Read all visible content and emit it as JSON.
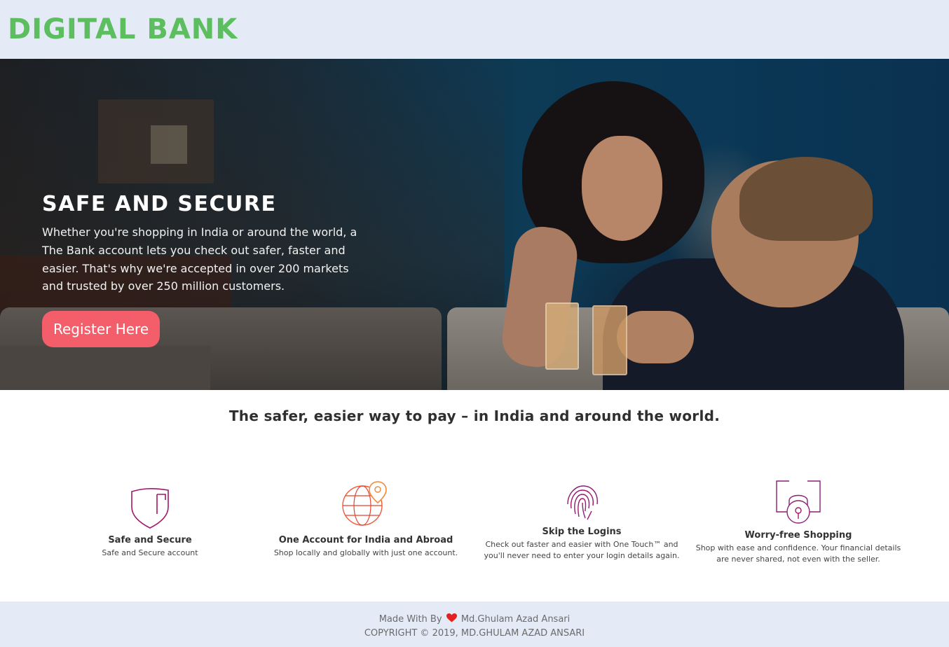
{
  "header": {
    "brand": "DIGITAL BANK"
  },
  "hero": {
    "title": "SAFE AND SECURE",
    "text": "Whether you're shopping in India or around the world, a The Bank account lets you check out safer, faster and easier. That's why we're accepted in over 200 markets and trusted by over 250 million customers.",
    "button_label": "Register Here"
  },
  "tagline": "The safer, easier way to pay – in India and around the world.",
  "features": [
    {
      "icon": "shield-icon",
      "title": "Safe and Secure",
      "desc": "Safe and Secure account"
    },
    {
      "icon": "globe-location-icon",
      "title": "One Account for India and Abroad",
      "desc": "Shop locally and globally with just one account."
    },
    {
      "icon": "fingerprint-icon",
      "title": "Skip the Logins",
      "desc": "Check out faster and easier with One Touch™ and you'll never need to enter your login details again."
    },
    {
      "icon": "lock-icon",
      "title": "Worry-free Shopping",
      "desc": "Shop with ease and confidence. Your financial details are never shared, not even with the seller."
    }
  ],
  "footer": {
    "made_with_prefix": "Made With By",
    "author": "Md.Ghulam Azad Ansari",
    "copyright": "COPYRIGHT © 2019, MD.GHULAM AZAD ANSARI"
  },
  "colors": {
    "brand": "#5cbe5f",
    "button": "#f35e6a",
    "header_bg": "#e4eaf6",
    "heart": "#e22222"
  }
}
